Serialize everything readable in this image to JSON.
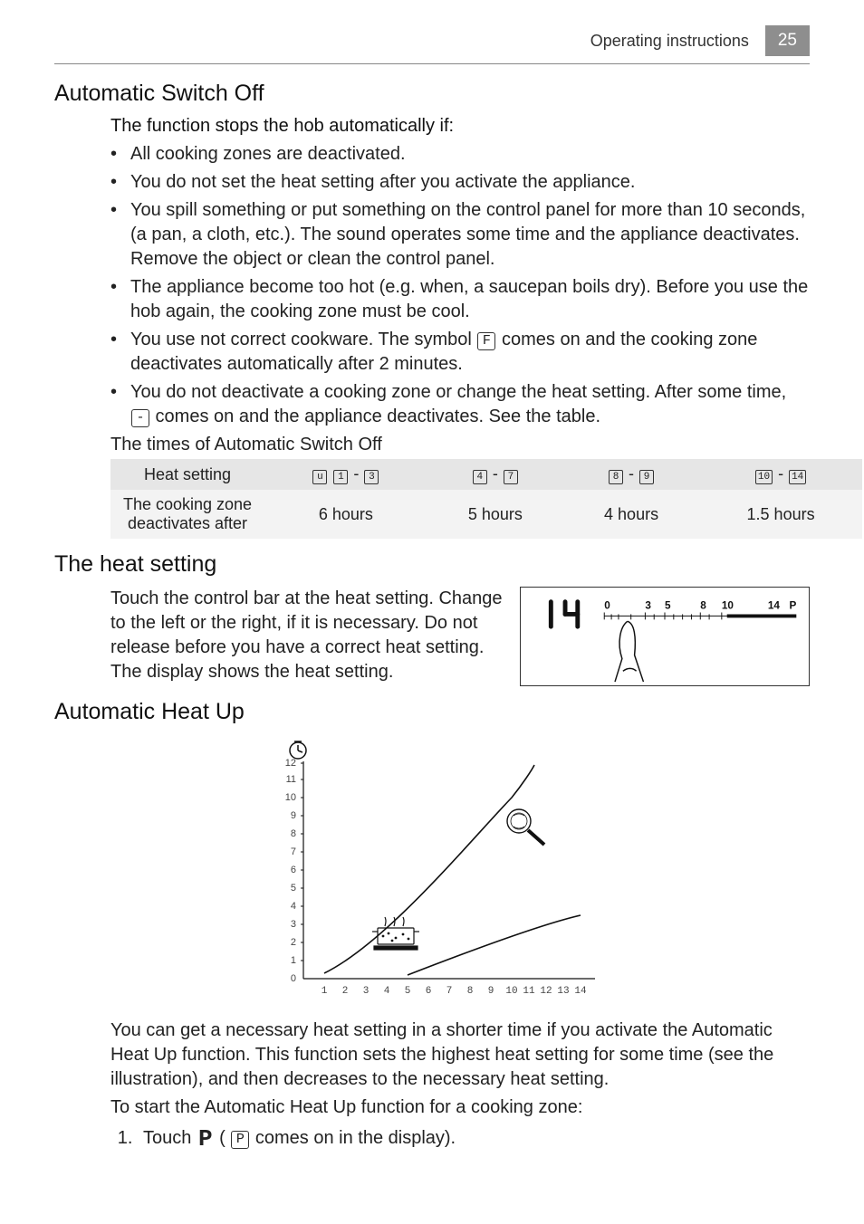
{
  "header": {
    "section": "Operating instructions",
    "page": "25"
  },
  "section1": {
    "title": "Automatic Switch Off",
    "intro": "The function stops the hob automatically if:",
    "bullets": {
      "b1": "All cooking zones are deactivated.",
      "b2": "You do not set the heat setting after you activate the appliance.",
      "b3": "You spill something or put something on the control panel for more than 10 seconds, (a pan, a cloth, etc.). The sound operates some time and the appliance deactivates. Remove the object or clean the control panel.",
      "b4": "The appliance become too hot (e.g. when, a saucepan boils dry). Before you use the hob again, the cooking zone must be cool.",
      "b5a": "You use not correct cookware. The symbol ",
      "b5b": " comes on and the cooking zone deactivates automatically after 2 minutes.",
      "b6a": "You do not deactivate a cooking zone or change the heat setting. After some time, ",
      "b6b": " comes on and the appliance deactivates. See the table."
    },
    "symbols": {
      "F": "F",
      "dash": "-"
    },
    "tableCaption": "The times of Automatic Switch Off",
    "table": {
      "h0": "Heat setting",
      "r0": "The cooking zone deactivates after",
      "d1": "6 hours",
      "d2": "5 hours",
      "d3": "4 hours",
      "d4": "1.5 hours",
      "range1": {
        "a": "u",
        "b": "1",
        "dash": "-",
        "c": "3"
      },
      "range2": {
        "a": "4",
        "dash": "-",
        "b": "7"
      },
      "range3": {
        "a": "8",
        "dash": "-",
        "b": "9"
      },
      "range4": {
        "a": "10",
        "dash": "-",
        "b": "14"
      }
    }
  },
  "section2": {
    "title": "The heat setting",
    "text": "Touch the control bar at the heat setting. Change to the left or the right, if it is necessary. Do not release before you have a correct heat setting. The display shows the heat setting.",
    "diagram": {
      "display": "14",
      "scale": [
        "0",
        "3",
        "5",
        "8",
        "10",
        "14",
        "P"
      ]
    }
  },
  "section3": {
    "title": "Automatic Heat Up",
    "para1": "You can get a necessary heat setting in a shorter time if you activate the Automatic Heat Up function. This function sets the highest heat setting for some time (see the illustration), and then decreases to the necessary heat setting.",
    "para2": "To start the Automatic Heat Up function for a cooking zone:",
    "step1a": "Touch ",
    "step1b": " ( ",
    "step1c": " comes on in the display).",
    "symbols": {
      "Pbig": "P",
      "Psmall": "P"
    }
  },
  "chart_data": {
    "type": "line",
    "title": "",
    "xlabel": "",
    "ylabel": "",
    "x_ticks": [
      1,
      2,
      3,
      4,
      5,
      6,
      7,
      8,
      9,
      10,
      11,
      12,
      13,
      14
    ],
    "y_ticks": [
      0,
      1,
      2,
      3,
      4,
      5,
      6,
      7,
      8,
      9,
      10,
      11,
      12
    ],
    "xlim": [
      0,
      14
    ],
    "ylim": [
      0,
      12
    ],
    "series": [
      {
        "name": "heat-curve-1",
        "points": [
          [
            1,
            0.3
          ],
          [
            5,
            3.2
          ],
          [
            10,
            10
          ],
          [
            11.1,
            11.8
          ]
        ]
      },
      {
        "name": "heat-curve-2",
        "points": [
          [
            5,
            0.2
          ],
          [
            14,
            3.5
          ]
        ]
      }
    ],
    "annotations": [
      {
        "name": "pot-icon",
        "x": 4.5,
        "y": 2.2
      },
      {
        "name": "magnifier-icon",
        "x": 10.5,
        "y": 8.8
      }
    ],
    "extras": {
      "clock-icon": true
    }
  }
}
